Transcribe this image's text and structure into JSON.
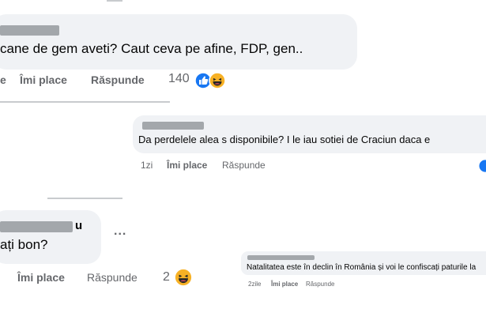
{
  "comment1": {
    "text": "cane de gem aveti? Caut ceva pe afine, FDP, gen..",
    "partial_action": "e",
    "like_label": "Îmi place",
    "reply_label": "Răspunde",
    "reaction_count": "140",
    "reactions": [
      "like-icon",
      "haha-icon"
    ]
  },
  "comment2": {
    "text": "Da perdelele alea s disponibile? I le iau sotiei de Craciun daca e",
    "time": "1zi",
    "like_label": "Îmi place",
    "reply_label": "Răspunde"
  },
  "comment3": {
    "partial_name": "u",
    "text": "ați bon?",
    "more_label": "...",
    "like_label": "Îmi place",
    "reply_label": "Răspunde",
    "reaction_count": "2",
    "reactions": [
      "haha-icon"
    ]
  },
  "comment4": {
    "text": "Natalitatea este în declin în România și voi le confiscați paturile la",
    "time": "2zile",
    "like_label": "Îmi place",
    "reply_label": "Răspunde"
  },
  "colors": {
    "bubble": "#f0f2f5",
    "meta_text": "#65676b",
    "like_blue": "#1877f2",
    "haha_yellow": "#f7b125"
  }
}
